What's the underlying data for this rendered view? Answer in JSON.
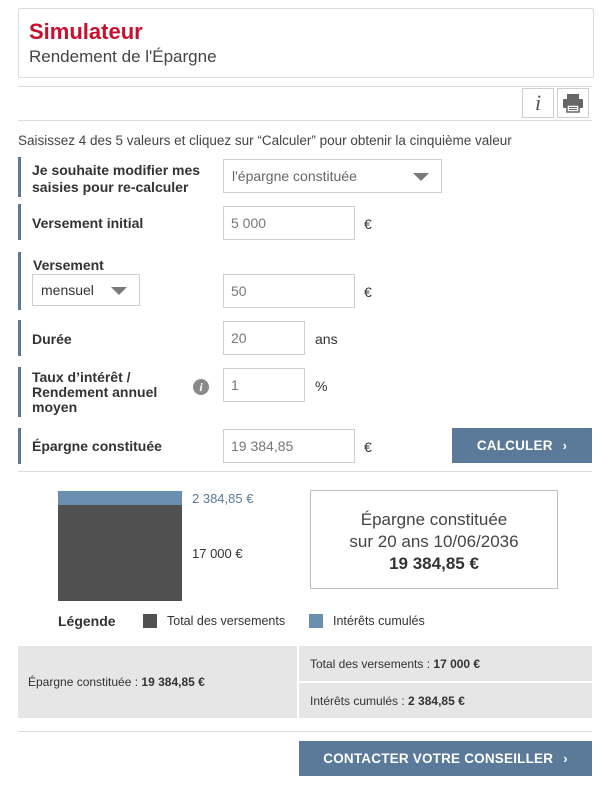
{
  "header": {
    "title": "Simulateur",
    "subtitle": "Rendement de l'Épargne"
  },
  "toolbar": {
    "info_icon": "info-icon",
    "print_icon": "print-icon"
  },
  "intro": "Saisissez 4 des 5 valeurs et cliquez sur “Calculer” pour obtenir la cinquième valeur",
  "form": {
    "modify": {
      "label": "Je souhaite modifier mes saisies pour re-calculer",
      "selected": "l'épargne constituée"
    },
    "initial": {
      "label": "Versement initial",
      "value": "5 000",
      "unit": "€"
    },
    "payment": {
      "label": "Versement",
      "frequency": "mensuel",
      "value": "50",
      "unit": "€"
    },
    "duration": {
      "label": "Durée",
      "value": "20",
      "unit": "ans"
    },
    "rate": {
      "label": "Taux d’intérêt / Rendement annuel moyen",
      "value": "1",
      "unit": "%"
    },
    "savings": {
      "label": "Épargne constituée",
      "value": "19 384,85",
      "unit": "€"
    },
    "calculate_label": "CALCULER"
  },
  "results": {
    "bar_top_label": "2 384,85 €",
    "bar_bottom_label": "17 000 €",
    "total_payments_value": 17000,
    "interest_value": 2384.85,
    "summary_line1": "Épargne constituée",
    "summary_line2": "sur 20 ans 10/06/2036",
    "summary_value": "19 384,85 €",
    "legend_title": "Légende",
    "legend_payments": "Total des versements",
    "legend_interest": "Intérêts cumulés",
    "colors": {
      "payments": "#505050",
      "interest": "#6a8fae",
      "accent": "#5b7a99",
      "brand": "#c8102e"
    }
  },
  "table": {
    "left_label": "Épargne constituée : ",
    "left_value": "19 384,85 €",
    "right_top_label": "Total des versements : ",
    "right_top_value": "17 000 €",
    "right_bottom_label": "Intérêts cumulés : ",
    "right_bottom_value": "2 384,85 €"
  },
  "contact_label": "CONTACTER VOTRE CONSEILLER"
}
